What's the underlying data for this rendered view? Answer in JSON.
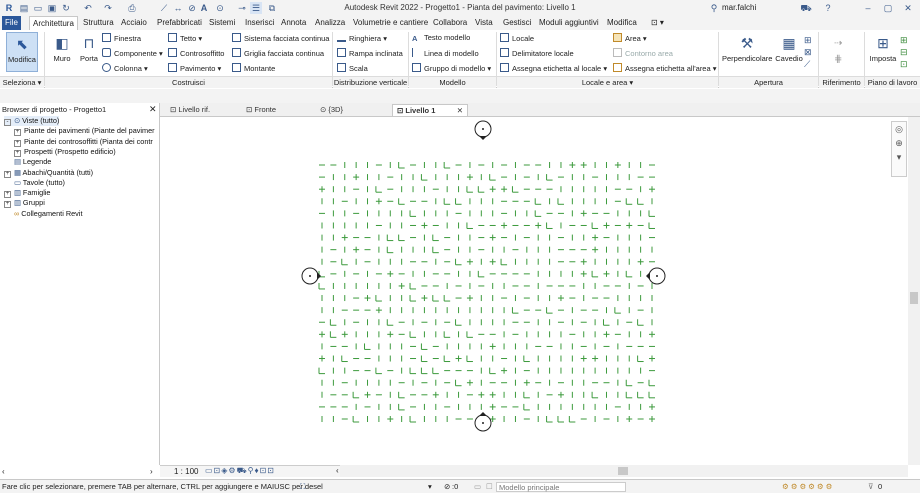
{
  "title": "Autodesk Revit 2022 - Progetto1 - Pianta del pavimento: Livello 1",
  "user": "mar.falchi",
  "tabs": [
    "File",
    "Architettura",
    "Struttura",
    "Acciaio",
    "Prefabbricati",
    "Sistemi",
    "Inserisci",
    "Annota",
    "Analizza",
    "Volumetrie e cantiere",
    "Collabora",
    "Vista",
    "Gestisci",
    "Moduli aggiuntivi",
    "Modifica"
  ],
  "active_tab": "Architettura",
  "ribbon": {
    "modifica": "Modifica",
    "muro": "Muro",
    "porta": "Porta",
    "finestra": "Finestra",
    "componente": "Componente",
    "colonna": "Colonna",
    "tetto": "Tetto",
    "controsoffitto": "Controsoffitto",
    "pavimento": "Pavimento",
    "sistema_facciata": "Sistema facciata continua",
    "griglia_facciata": "Griglia facciata continua",
    "montante": "Montante",
    "ringhiera": "Ringhiera",
    "rampa": "Rampa inclinata",
    "scala": "Scala",
    "testo_modello": "Testo modello",
    "linea_modello": "Linea di modello",
    "gruppo_modello": "Gruppo di modello",
    "locale": "Locale",
    "delimitatore": "Delimitatore locale",
    "etichetta_locale": "Assegna etichetta  al locale",
    "area": "Area",
    "contorno_area": "Contorno  area",
    "etichetta_area": "Assegna etichetta  all'area",
    "perpendicolare": "Perpendicolare",
    "cavedio": "Cavedio",
    "imposta": "Imposta",
    "groups": {
      "seleziona": "Seleziona",
      "costruisci": "Costruisci",
      "distribuzione": "Distribuzione verticale",
      "modello": "Modello",
      "locale_area": "Locale e area",
      "apertura": "Apertura",
      "riferimento": "Riferimento",
      "piano": "Piano di lavoro"
    }
  },
  "browser": {
    "header": "Browser di progetto - Progetto1",
    "items": [
      {
        "label": "Viste (tutto)",
        "level": 0,
        "toggle": "-"
      },
      {
        "label": "Piante dei pavimenti (Piante del pavimer",
        "level": 1,
        "toggle": "+"
      },
      {
        "label": "Piante dei controsoffitti (Pianta dei contr",
        "level": 1,
        "toggle": "+"
      },
      {
        "label": "Prospetti (Prospetto edificio)",
        "level": 1,
        "toggle": "+"
      },
      {
        "label": "Legende",
        "level": 0,
        "toggle": ""
      },
      {
        "label": "Abachi/Quantità (tutti)",
        "level": 0,
        "toggle": "+"
      },
      {
        "label": "Tavole (tutto)",
        "level": 0,
        "toggle": ""
      },
      {
        "label": "Famiglie",
        "level": 0,
        "toggle": "+"
      },
      {
        "label": "Gruppi",
        "level": 0,
        "toggle": "+"
      },
      {
        "label": "Collegamenti Revit",
        "level": 0,
        "toggle": ""
      }
    ]
  },
  "view_tabs": [
    "Livello rif.",
    "Fronte",
    "{3D}",
    "Livello 1"
  ],
  "active_view": "Livello 1",
  "scale": "1 : 100",
  "status": "Fare clic per selezionare, premere TAB per alternare, CTRL per aggiungere e MAIUSC per desel",
  "status_zero": ":0",
  "model": "Modello principale",
  "filter_count": "0",
  "colors": {
    "accent": "#2b579a",
    "drawing": "#3c9a3c"
  }
}
